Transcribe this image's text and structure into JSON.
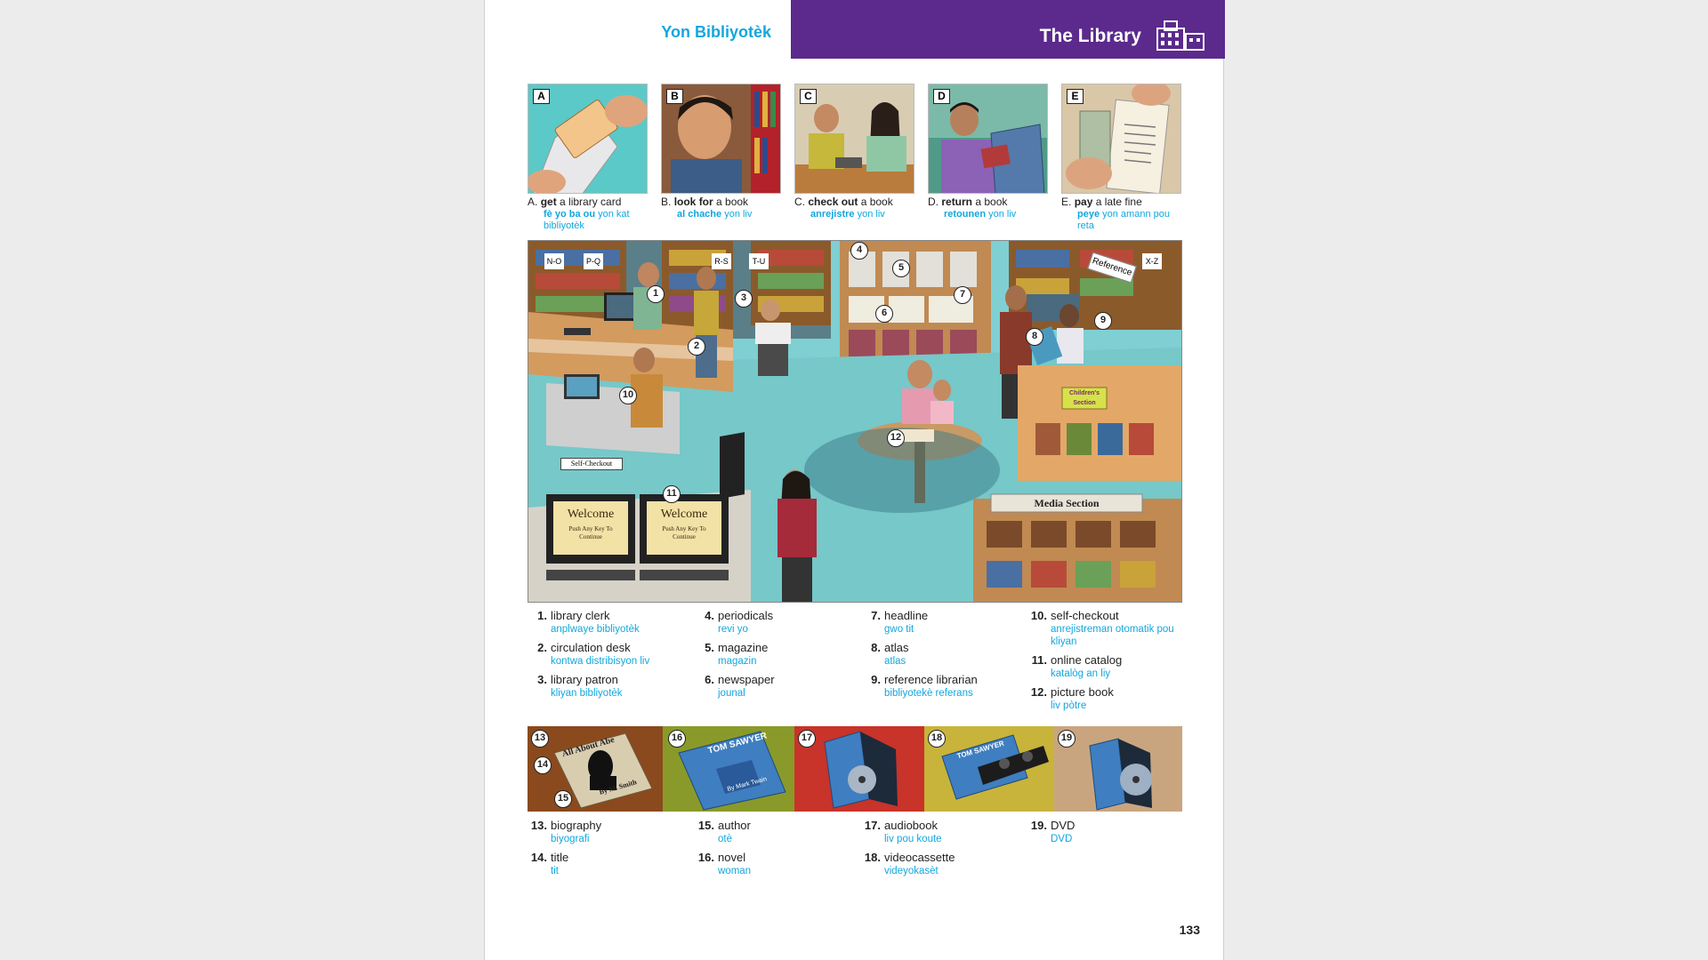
{
  "header": {
    "left_title": "Yon Bibliyotèk",
    "right_title": "The Library",
    "icon": "library-building-icon",
    "accent_purple": "#5b2a8c",
    "accent_blue": "#12a7de"
  },
  "verbs": [
    {
      "letter": "A",
      "prefix": "A.",
      "bold": "get",
      "rest": " a library card",
      "ht_bold": "fè yo ba ou",
      "ht_rest": " yon kat bibliyotèk"
    },
    {
      "letter": "B",
      "prefix": "B.",
      "bold": "look for",
      "rest": " a book",
      "ht_bold": "al chache",
      "ht_rest": " yon liv"
    },
    {
      "letter": "C",
      "prefix": "C.",
      "bold": "check out",
      "rest": " a book",
      "ht_bold": "anrejistre",
      "ht_rest": " yon liv"
    },
    {
      "letter": "D",
      "prefix": "D.",
      "bold": "return",
      "rest": " a book",
      "ht_bold": "retounen",
      "ht_rest": " yon liv"
    },
    {
      "letter": "E",
      "prefix": "E.",
      "bold": "pay",
      "rest": " a late fine",
      "ht_bold": "peye",
      "ht_rest": " yon amann pou reta"
    }
  ],
  "scene": {
    "signs": [
      "N-O",
      "P-Q",
      "R-S",
      "T-U",
      "X-Z"
    ],
    "reference_sign": "Reference",
    "self_checkout_sign": "Self-Checkout",
    "media_sign": "Media Section",
    "childrens_sign": "Children's Section",
    "welcome": "Welcome",
    "welcome_sub": "Push Any Key To Continue"
  },
  "vocab": [
    {
      "n": "1.",
      "en": "library clerk",
      "ht": "anplwaye bibliyotèk"
    },
    {
      "n": "2.",
      "en": "circulation desk",
      "ht": "kontwa distribisyon liv"
    },
    {
      "n": "3.",
      "en": "library patron",
      "ht": "kliyan bibliyotèk"
    },
    {
      "n": "4.",
      "en": "periodicals",
      "ht": "revi yo"
    },
    {
      "n": "5.",
      "en": "magazine",
      "ht": "magazin"
    },
    {
      "n": "6.",
      "en": "newspaper",
      "ht": "jounal"
    },
    {
      "n": "7.",
      "en": "headline",
      "ht": "gwo tit"
    },
    {
      "n": "8.",
      "en": "atlas",
      "ht": "atlas"
    },
    {
      "n": "9.",
      "en": "reference librarian",
      "ht": "bibliyotekè referans"
    },
    {
      "n": "10.",
      "en": "self-checkout",
      "ht": "anrejistreman otomatik pou kliyan"
    },
    {
      "n": "11.",
      "en": "online catalog",
      "ht": "katalòg an liy"
    },
    {
      "n": "12.",
      "en": "picture book",
      "ht": "liv pòtre"
    },
    {
      "n": "13.",
      "en": "biography",
      "ht": "biyografi"
    },
    {
      "n": "14.",
      "en": "title",
      "ht": "tit"
    },
    {
      "n": "15.",
      "en": "author",
      "ht": "otè"
    },
    {
      "n": "16.",
      "en": "novel",
      "ht": "woman"
    },
    {
      "n": "17.",
      "en": "audiobook",
      "ht": "liv pou koute"
    },
    {
      "n": "18.",
      "en": "videocassette",
      "ht": "videyokasèt"
    },
    {
      "n": "19.",
      "en": "DVD",
      "ht": "DVD"
    }
  ],
  "strip": {
    "bio_title": "All About Abe",
    "bio_author": "By M. Smith",
    "novel_title": "TOM SAWYER",
    "novel_author": "By Mark Twain"
  },
  "page_number": "133"
}
